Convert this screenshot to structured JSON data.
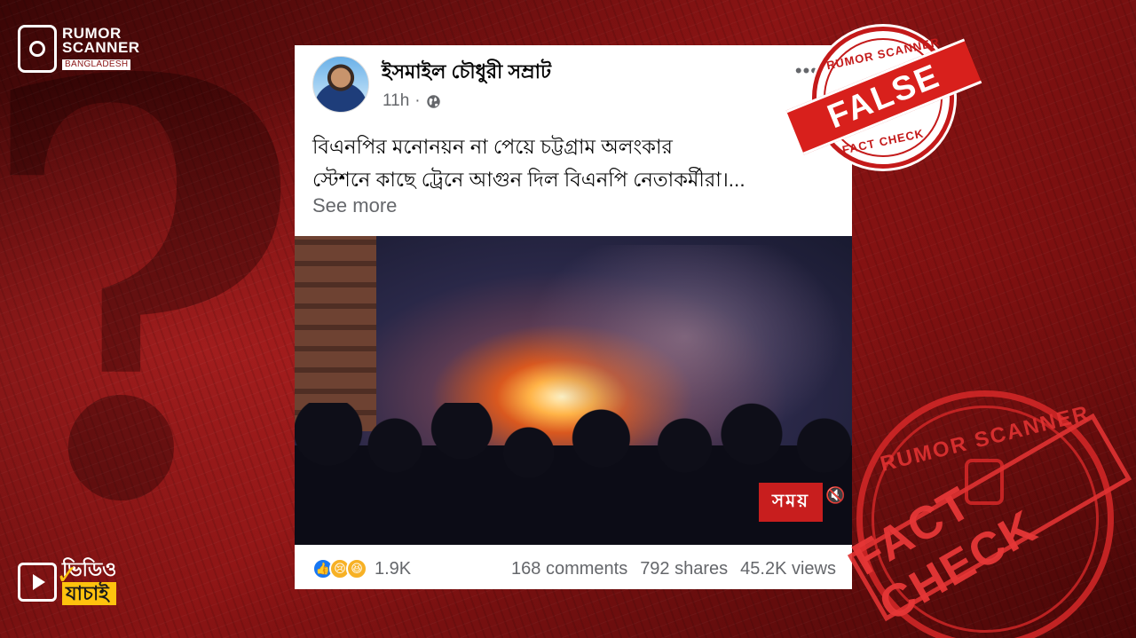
{
  "brand": {
    "line1": "RUMOR",
    "line2": "SCANNER",
    "sub": "BANGLADESH",
    "icon": "phone-search-icon"
  },
  "post": {
    "author": "ইসমাইল চৌধুরী সম্রাট",
    "time": "11h",
    "audience_icon": "globe-icon",
    "caption_line1": "বিএনপির মনোনয়ন না পেয়ে চট্টগ্রাম অলংকার",
    "caption_line2": "স্টেশনে কাছে ট্রেনে আগুন দিল বিএনপি নেতাকর্মীরা।...",
    "see_more": "See more",
    "video": {
      "watermark": "সময়",
      "mute_icon": "speaker-muted-icon"
    },
    "stats": {
      "reaction_count": "1.9K",
      "comments": "168 comments",
      "shares": "792 shares",
      "views": "45.2K views"
    }
  },
  "stamp_false": {
    "top": "RUMOR SCANNER",
    "label": "FALSE",
    "bottom": "FACT CHECK"
  },
  "stamp_big": {
    "top": "RUMOR SCANNER",
    "band": "FACT CHECK"
  },
  "video_jachai": {
    "line1": "ভিডিও",
    "line2": "যাচাই"
  },
  "colors": {
    "accent": "#c41a1a",
    "brand_yellow": "#ffc20e",
    "fb_blue": "#1877f2"
  }
}
